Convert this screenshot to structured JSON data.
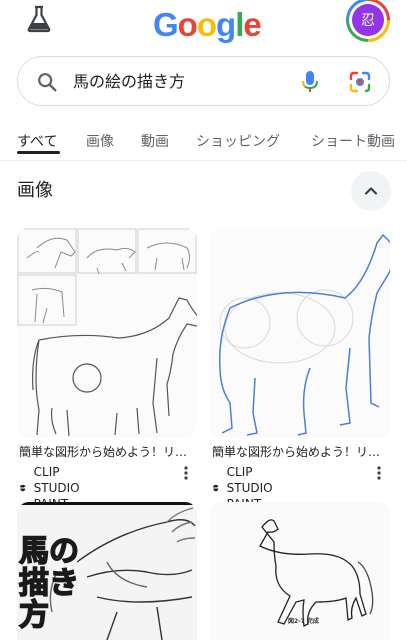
{
  "header": {
    "logo_text": "Google",
    "logo_colors": [
      "#4285f4",
      "#ea4335",
      "#fbbc05",
      "#4285f4",
      "#34a853",
      "#ea4335"
    ],
    "labs_icon": "flask-icon",
    "avatar_initial": "忍",
    "avatar_color": "#9334e6"
  },
  "search": {
    "query": "馬の絵の描き方",
    "search_icon": "search-icon",
    "mic_icon": "mic-icon",
    "lens_icon": "lens-icon"
  },
  "tabs": [
    {
      "label": "すべて",
      "active": true
    },
    {
      "label": "画像",
      "active": false
    },
    {
      "label": "動画",
      "active": false
    },
    {
      "label": "ショッピング",
      "active": false
    },
    {
      "label": "ショート動画",
      "active": false
    }
  ],
  "images_section": {
    "title": "画像",
    "collapse_icon": "chevron-up-icon",
    "results": [
      {
        "caption": "簡単な図形から始めよう！リ…",
        "source": "CLIP STUDIO PAINT",
        "source_icon": "clip-studio-logo"
      },
      {
        "caption": "簡単な図形から始めよう！リ…",
        "source": "CLIP STUDIO PAINT",
        "source_icon": "clip-studio-logo"
      },
      {
        "overlay_text": "馬の描き方"
      },
      {
        "figure_caption": "図2-7 完成"
      }
    ]
  },
  "colors": {
    "accent": "#1a73e8",
    "text": "#202124",
    "secondary_text": "#5f6368",
    "divider": "#dadce0"
  }
}
